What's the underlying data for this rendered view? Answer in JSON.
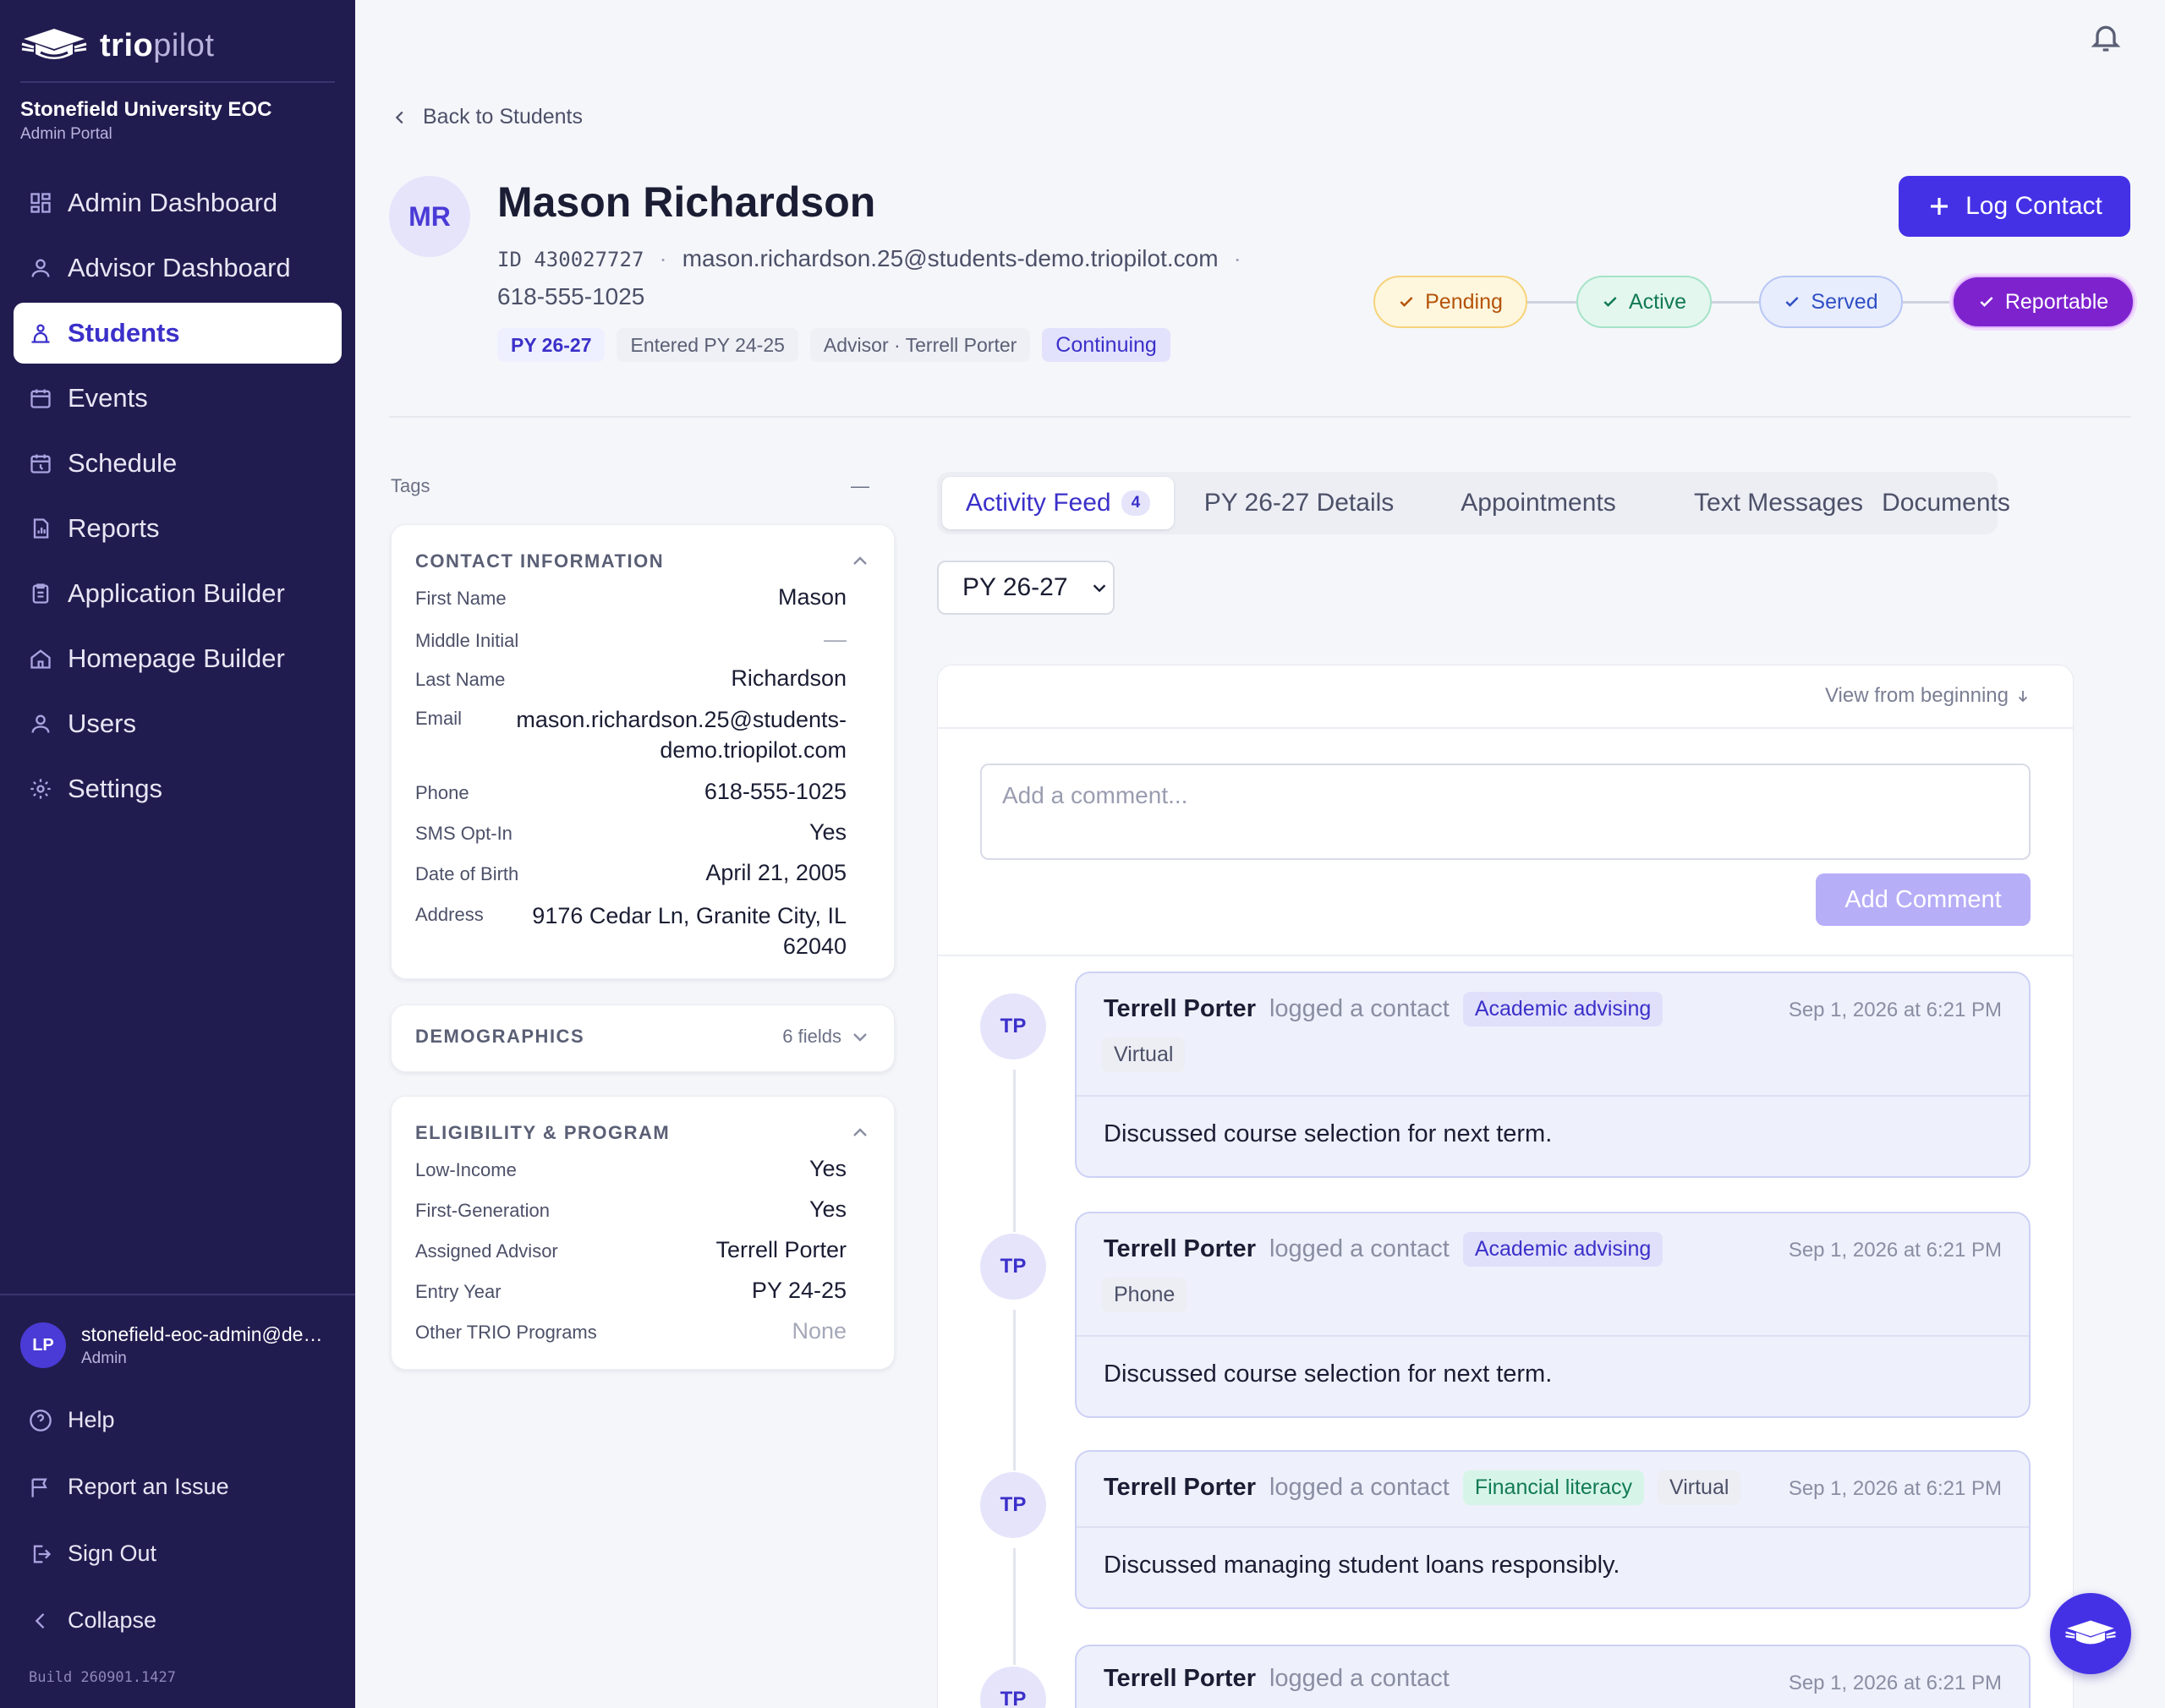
{
  "brand": {
    "name_bold": "trio",
    "name_light": "pilot",
    "org": "Stonefield University EOC",
    "portal": "Admin Portal"
  },
  "nav": [
    {
      "label": "Admin Dashboard",
      "icon": "grid-icon"
    },
    {
      "label": "Advisor Dashboard",
      "icon": "person-icon"
    },
    {
      "label": "Students",
      "icon": "students-icon",
      "active": true
    },
    {
      "label": "Events",
      "icon": "calendar-icon"
    },
    {
      "label": "Schedule",
      "icon": "schedule-icon"
    },
    {
      "label": "Reports",
      "icon": "report-icon"
    },
    {
      "label": "Application Builder",
      "icon": "clipboard-icon"
    },
    {
      "label": "Homepage Builder",
      "icon": "home-icon"
    },
    {
      "label": "Users",
      "icon": "users-icon"
    },
    {
      "label": "Settings",
      "icon": "gear-icon"
    }
  ],
  "account": {
    "initials": "LP",
    "email": "stonefield-eoc-admin@demo.triopilot.com",
    "role": "Admin"
  },
  "side_links": {
    "help": "Help",
    "report": "Report an Issue",
    "signout": "Sign Out",
    "collapse": "Collapse"
  },
  "build": "Build 260901.1427",
  "back_label": "Back to Students",
  "student": {
    "initials": "MR",
    "name": "Mason Richardson",
    "id": "ID 430027727",
    "email": "mason.richardson.25@students-demo.triopilot.com",
    "phone": "618-555-1025",
    "chips": {
      "py": "PY 26-27",
      "entered": "Entered PY 24-25",
      "advisor": "Advisor · Terrell Porter",
      "status": "Continuing"
    }
  },
  "log_contact_label": "Log Contact",
  "pipeline": [
    {
      "label": "Pending",
      "color": "#b45309",
      "bg": "#fef6dd",
      "border": "#f6d37a"
    },
    {
      "label": "Active",
      "color": "#117a52",
      "bg": "#e3f7ee",
      "border": "#a5e3c8"
    },
    {
      "label": "Served",
      "color": "#2f4fc4",
      "bg": "#e8edfd",
      "border": "#b7c6f5"
    },
    {
      "label": "Reportable",
      "color": "#ffffff",
      "bg": "#7e22ce",
      "border": "#e0b6fb"
    }
  ],
  "tags": {
    "label": "Tags",
    "value": "—"
  },
  "contact": {
    "title": "CONTACT INFORMATION",
    "rows": [
      {
        "k": "First Name",
        "v": "Mason"
      },
      {
        "k": "Middle Initial",
        "v": "—"
      },
      {
        "k": "Last Name",
        "v": "Richardson"
      },
      {
        "k": "Email",
        "v": "mason.richardson.25@students-demo.triopilot.com"
      },
      {
        "k": "Phone",
        "v": "618-555-1025"
      },
      {
        "k": "SMS Opt-In",
        "v": "Yes"
      },
      {
        "k": "Date of Birth",
        "v": "April 21, 2005"
      },
      {
        "k": "Address",
        "v": "9176 Cedar Ln, Granite City, IL 62040"
      }
    ]
  },
  "demographics": {
    "title": "DEMOGRAPHICS",
    "count": "6 fields"
  },
  "eligibility": {
    "title": "ELIGIBILITY & PROGRAM",
    "rows": [
      {
        "k": "Low-Income",
        "v": "Yes"
      },
      {
        "k": "First-Generation",
        "v": "Yes"
      },
      {
        "k": "Assigned Advisor",
        "v": "Terrell Porter"
      },
      {
        "k": "Entry Year",
        "v": "PY 24-25"
      },
      {
        "k": "Other TRIO Programs",
        "v": "None"
      }
    ]
  },
  "tabs": [
    {
      "label": "Activity Feed",
      "count": "4",
      "active": true
    },
    {
      "label": "PY 26-27 Details"
    },
    {
      "label": "Appointments"
    },
    {
      "label": "Text Messages"
    },
    {
      "label": "Documents"
    }
  ],
  "py_select": "PY 26-27",
  "feed": {
    "view_from_beginning": "View from beginning",
    "comment_placeholder": "Add a comment...",
    "add_comment": "Add Comment",
    "items": [
      {
        "initials": "TP",
        "who": "Terrell Porter",
        "verb": "logged a contact",
        "tag": "Academic advising",
        "mode": "Virtual",
        "time": "Sep 1, 2026 at 6:21 PM",
        "note": "Discussed course selection for next term."
      },
      {
        "initials": "TP",
        "who": "Terrell Porter",
        "verb": "logged a contact",
        "tag": "Academic advising",
        "mode": "Phone",
        "time": "Sep 1, 2026 at 6:21 PM",
        "note": "Discussed course selection for next term."
      },
      {
        "initials": "TP",
        "who": "Terrell Porter",
        "verb": "logged a contact",
        "tag": "Financial literacy",
        "mode": "Virtual",
        "time": "Sep 1, 2026 at 6:21 PM",
        "note": "Discussed managing student loans responsibly."
      },
      {
        "initials": "TP",
        "who": "Terrell Porter",
        "verb": "logged a contact",
        "time": "Sep 1, 2026 at 6:21 PM"
      }
    ]
  }
}
